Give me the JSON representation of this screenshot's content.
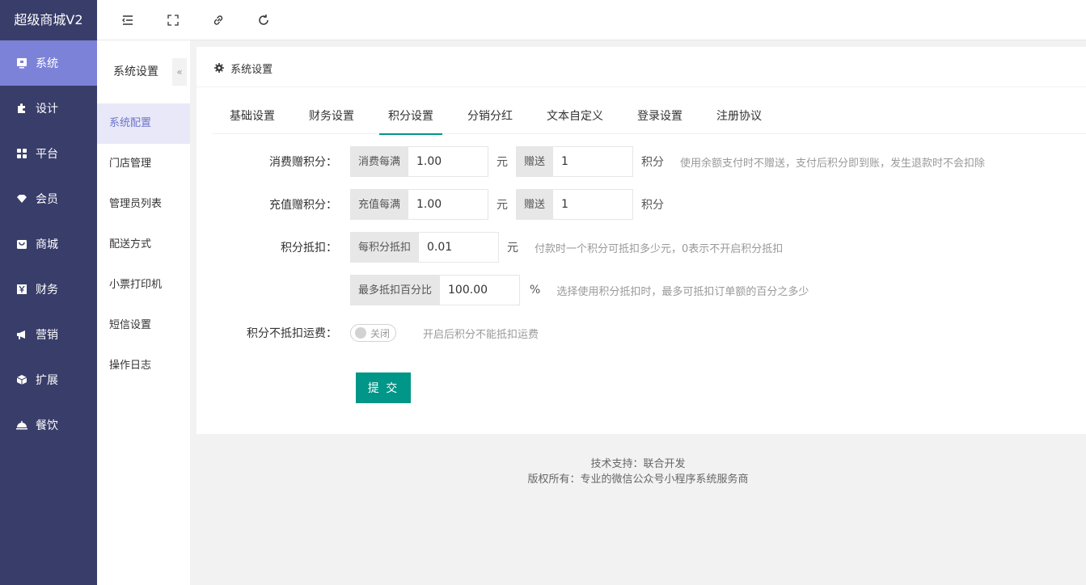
{
  "brand": "超级商城V2",
  "nav": [
    {
      "label": "系统",
      "icon": "monitor-icon"
    },
    {
      "label": "设计",
      "icon": "puzzle-icon"
    },
    {
      "label": "平台",
      "icon": "grid-icon"
    },
    {
      "label": "会员",
      "icon": "diamond-icon"
    },
    {
      "label": "商城",
      "icon": "bag-icon"
    },
    {
      "label": "财务",
      "icon": "yen-icon"
    },
    {
      "label": "营销",
      "icon": "megaphone-icon"
    },
    {
      "label": "扩展",
      "icon": "cube-icon"
    },
    {
      "label": "餐饮",
      "icon": "dish-icon"
    }
  ],
  "sub": {
    "title": "系统设置",
    "collapse": "«",
    "items": [
      "系统配置",
      "门店管理",
      "管理员列表",
      "配送方式",
      "小票打印机",
      "短信设置",
      "操作日志"
    ]
  },
  "card": {
    "title": "系统设置",
    "tabs": [
      "基础设置",
      "财务设置",
      "积分设置",
      "分销分红",
      "文本自定义",
      "登录设置",
      "注册协议"
    ],
    "active_tab": "积分设置"
  },
  "form": {
    "consume": {
      "label": "消费赠积分：",
      "prefix": "消费每满",
      "value": "1.00",
      "unit": "元",
      "give_prefix": "赠送",
      "give_value": "1",
      "give_unit": "积分",
      "tip": "使用余额支付时不赠送，支付后积分即到账，发生退款时不会扣除"
    },
    "recharge": {
      "label": "充值赠积分：",
      "prefix": "充值每满",
      "value": "1.00",
      "unit": "元",
      "give_prefix": "赠送",
      "give_value": "1",
      "give_unit": "积分"
    },
    "deduct": {
      "label": "积分抵扣：",
      "prefix": "每积分抵扣",
      "value": "0.01",
      "unit": "元",
      "tip": "付款时一个积分可抵扣多少元，0表示不开启积分抵扣"
    },
    "max_percent": {
      "prefix": "最多抵扣百分比",
      "value": "100.00",
      "unit": "%",
      "tip": "选择使用积分抵扣时，最多可抵扣订单额的百分之多少"
    },
    "freight": {
      "label": "积分不抵扣运费：",
      "switch_text": "关闭",
      "tip": "开启后积分不能抵扣运费"
    },
    "submit": "提 交"
  },
  "footer": {
    "line1": "技术支持：联合开发",
    "line2": "版权所有：专业的微信公众号小程序系统服务商"
  }
}
